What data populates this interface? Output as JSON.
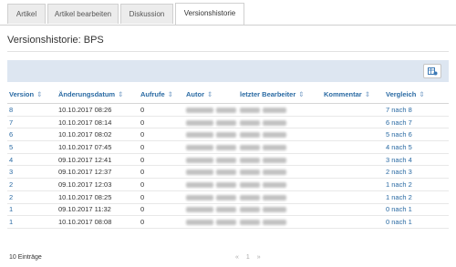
{
  "tabs": [
    {
      "label": "Artikel"
    },
    {
      "label": "Artikel bearbeiten"
    },
    {
      "label": "Diskussion"
    },
    {
      "label": "Versionshistorie"
    }
  ],
  "page_title": "Versionshistorie: BPS",
  "toolbar": {
    "icon": "export-icon"
  },
  "table": {
    "headers": [
      "Version",
      "Änderungsdatum",
      "Aufrufe",
      "Autor",
      "letzter Bearbeiter",
      "Kommentar",
      "Vergleich"
    ],
    "rows": [
      {
        "version": "8",
        "date": "10.10.2017 08:26",
        "views": "0",
        "compare": "7 nach 8"
      },
      {
        "version": "7",
        "date": "10.10.2017 08:14",
        "views": "0",
        "compare": "6 nach 7"
      },
      {
        "version": "6",
        "date": "10.10.2017 08:02",
        "views": "0",
        "compare": "5 nach 6"
      },
      {
        "version": "5",
        "date": "10.10.2017 07:45",
        "views": "0",
        "compare": "4 nach 5"
      },
      {
        "version": "4",
        "date": "09.10.2017 12:41",
        "views": "0",
        "compare": "3 nach 4"
      },
      {
        "version": "3",
        "date": "09.10.2017 12:37",
        "views": "0",
        "compare": "2 nach 3"
      },
      {
        "version": "2",
        "date": "09.10.2017 12:03",
        "views": "0",
        "compare": "1 nach 2"
      },
      {
        "version": "2",
        "date": "10.10.2017 08:25",
        "views": "0",
        "compare": "1 nach 2"
      },
      {
        "version": "1",
        "date": "09.10.2017 11:32",
        "views": "0",
        "compare": "0 nach 1"
      },
      {
        "version": "1",
        "date": "10.10.2017 08:08",
        "views": "0",
        "compare": "0 nach 1"
      }
    ]
  },
  "footer": {
    "count": "10 Einträge",
    "pager_prev": "«",
    "pager_page": "1",
    "pager_next": "»"
  },
  "colors": {
    "accent": "#2a6aa3",
    "toolbar_bg": "#dde6f1"
  }
}
